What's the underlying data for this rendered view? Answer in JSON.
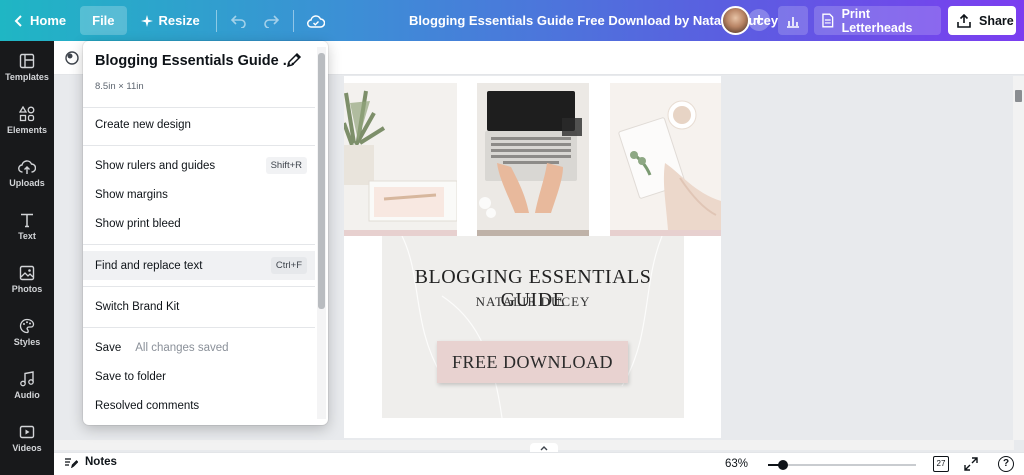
{
  "topbar": {
    "home_label": "Home",
    "file_label": "File",
    "resize_label": "Resize",
    "document_title": "Blogging Essentials Guide Free Download by Natalie Ducey",
    "print_label": "Print Letterheads",
    "share_label": "Share",
    "plus_label": "+"
  },
  "sidebar": {
    "items": [
      {
        "label": "Templates",
        "icon": "templates-icon"
      },
      {
        "label": "Elements",
        "icon": "elements-icon"
      },
      {
        "label": "Uploads",
        "icon": "upload-cloud-icon"
      },
      {
        "label": "Text",
        "icon": "text-t-icon"
      },
      {
        "label": "Photos",
        "icon": "photo-icon"
      },
      {
        "label": "Styles",
        "icon": "palette-icon"
      },
      {
        "label": "Audio",
        "icon": "music-note-icon"
      },
      {
        "label": "Videos",
        "icon": "video-play-icon"
      }
    ]
  },
  "file_menu": {
    "title": "Blogging Essentials Guide ...",
    "dimensions": "8.5in × 11in",
    "create_new": "Create new design",
    "show_rulers": "Show rulers and guides",
    "show_rulers_shortcut": "Shift+R",
    "show_margins": "Show margins",
    "show_print_bleed": "Show print bleed",
    "find_replace": "Find and replace text",
    "find_replace_shortcut": "Ctrl+F",
    "switch_brand": "Switch Brand Kit",
    "save": "Save",
    "save_status": "All changes saved",
    "save_to_folder": "Save to folder",
    "resolved_comments": "Resolved comments"
  },
  "design": {
    "title": "BLOGGING ESSENTIALS GUIDE",
    "author": "NATALIE DUCEY",
    "button": "FREE DOWNLOAD"
  },
  "bottombar": {
    "notes_label": "Notes",
    "zoom": "63%",
    "zoom_fraction": 0.1,
    "page_count": "27",
    "help": "?"
  },
  "colors": {
    "gradient_start": "#1fb6c4",
    "gradient_end": "#7b3ef0",
    "sidebar_bg": "#18191b",
    "accent_pink": "#e8d2d0"
  }
}
